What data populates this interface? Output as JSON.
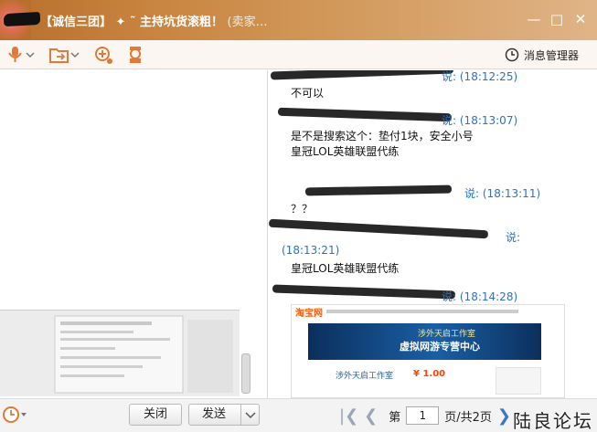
{
  "window": {
    "title": "【诚信三团】 ✦ ˜ 主持坑货滚粗！",
    "title_suffix": "(卖家…",
    "controls": [
      "—",
      "□",
      "✕"
    ]
  },
  "toolbar": {
    "message_manager_label": "消息管理器",
    "icons": [
      "mic-icon",
      "folder-send-icon",
      "add-contact-icon",
      "robot-icon"
    ]
  },
  "chat": {
    "messages": [
      {
        "time": "(18:12:25)",
        "say": "说:",
        "lines": [
          "不可以"
        ]
      },
      {
        "time": "(18:13:07)",
        "say": "说:",
        "lines": [
          "是不是搜索这个：垫付1块，安全小号",
          "皇冠LOL英雄联盟代练"
        ]
      },
      {
        "time": "(18:13:11)",
        "say": "说:",
        "lines": [
          "？？"
        ]
      },
      {
        "time": "(18:13:21)",
        "say": "说:",
        "lines": [
          "皇冠LOL英雄联盟代练"
        ]
      },
      {
        "time": "(18:14:28)",
        "say": "说:",
        "lines": []
      }
    ],
    "preview": {
      "logo": "淘宝网",
      "banner_line1": "涉外天启工作室",
      "banner_line2": "虚拟网游专营中心",
      "item_title": "涉外天启工作室",
      "price": "¥ 1.00"
    }
  },
  "bottom": {
    "close_label": "关闭",
    "send_label": "发送",
    "page_prefix": "第",
    "page_value": "1",
    "page_suffix": "页/共2页",
    "watermark": "陆良论坛"
  },
  "colors": {
    "title_bar": "#c8843f",
    "sender_green": "#1b8a1b",
    "say_blue": "#2b73c2"
  }
}
